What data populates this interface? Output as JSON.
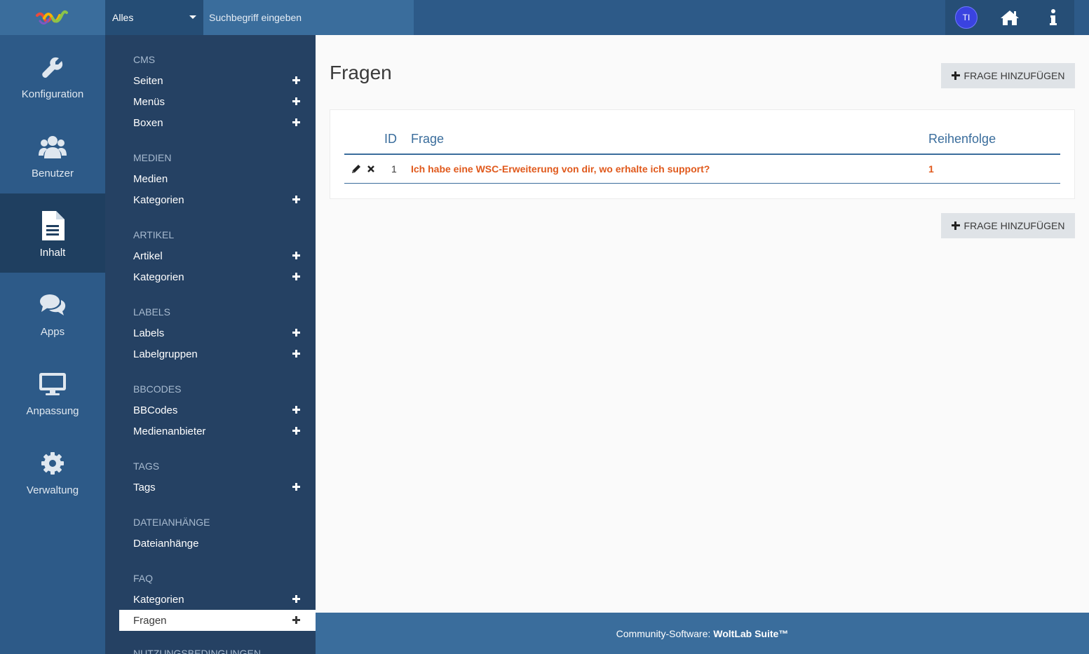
{
  "search": {
    "scope": "Alles",
    "placeholder": "Suchbegriff eingeben"
  },
  "user": {
    "initials": "TI"
  },
  "main_menu": [
    {
      "label": "Konfiguration",
      "icon": "wrench-icon"
    },
    {
      "label": "Benutzer",
      "icon": "users-icon"
    },
    {
      "label": "Inhalt",
      "icon": "file-text-icon",
      "active": true
    },
    {
      "label": "Apps",
      "icon": "comments-icon"
    },
    {
      "label": "Anpassung",
      "icon": "desktop-icon"
    },
    {
      "label": "Verwaltung",
      "icon": "gear-icon"
    }
  ],
  "sub_menu": {
    "categories": [
      "CMS",
      "Medien",
      "Artikel",
      "Labels",
      "BBCodes",
      "Tags",
      "Dateianhänge",
      "FAQ",
      "Nutzungsbedingungen"
    ],
    "items": [
      "Seiten",
      "Menüs",
      "Boxen",
      "Medien",
      "Kategorien",
      "Artikel",
      "Kategorien",
      "Labels",
      "Labelgruppen",
      "BBCodes",
      "Medienanbieter",
      "Tags",
      "Dateianhänge",
      "Kategorien",
      "Fragen"
    ]
  },
  "page": {
    "title": "Fragen",
    "add_button": "Frage hinzufügen"
  },
  "table": {
    "headers": {
      "id": "ID",
      "question": "Frage",
      "order": "Reihenfolge"
    },
    "rows": [
      {
        "id": "1",
        "question": "Ich habe eine WSC-Erweiterung von dir, wo erhalte ich support?",
        "order": "1"
      }
    ]
  },
  "footer": {
    "prefix": "Community-Software:",
    "brand": "WoltLab Suite™"
  },
  "colors": {
    "topbar": "#2d5a88",
    "submenu": "#254163",
    "accent_link": "#e0591c",
    "header_blue": "#3a6d9c"
  }
}
